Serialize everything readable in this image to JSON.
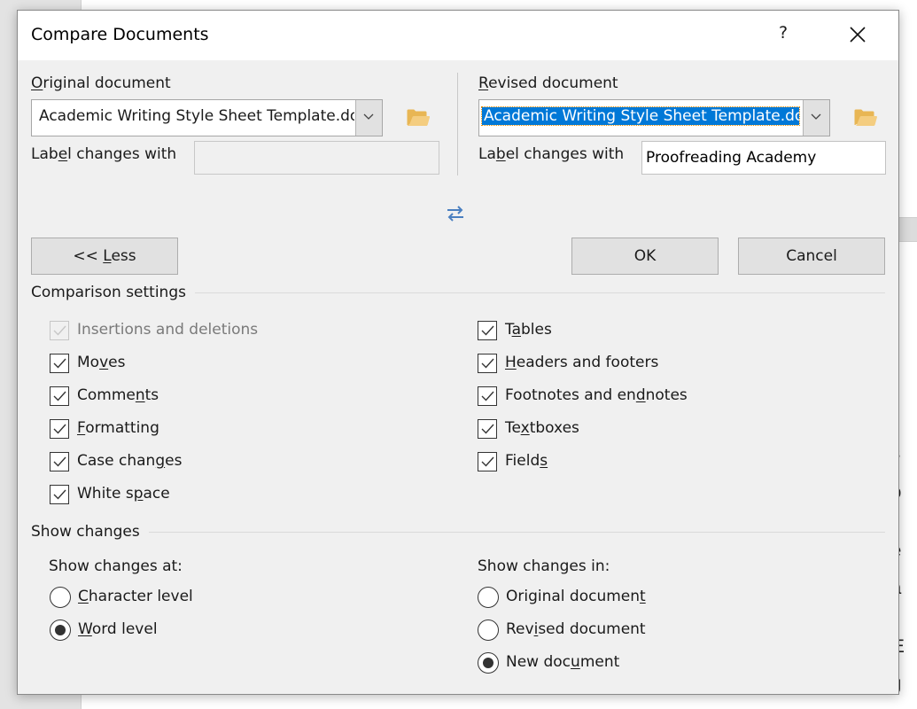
{
  "background": {
    "text_fragments": [
      "es",
      "bo",
      "he",
      "da",
      "r E",
      "ng"
    ]
  },
  "dialog": {
    "title": "Compare Documents",
    "help_label": "?",
    "original": {
      "heading_pre": "",
      "heading_ul": "O",
      "heading_post": "riginal document",
      "file": "Academic Writing Style Sheet Template.docx",
      "label_pre": "Lab",
      "label_ul": "e",
      "label_post": "l changes with",
      "label_value": ""
    },
    "revised": {
      "heading_pre": "",
      "heading_ul": "R",
      "heading_post": "evised document",
      "file": "Academic Writing Style Sheet Template.docx",
      "label_pre": "La",
      "label_ul": "b",
      "label_post": "el changes with",
      "label_value": "Proofreading Academy"
    },
    "buttons": {
      "less_pre": "<< ",
      "less_ul": "L",
      "less_post": "ess",
      "ok": "OK",
      "cancel": "Cancel"
    },
    "comparison_settings": {
      "title": "Comparison settings",
      "left": [
        {
          "pre": "Insertions and deletions",
          "ul": "",
          "post": "",
          "checked": true,
          "disabled": true
        },
        {
          "pre": "Mo",
          "ul": "v",
          "post": "es",
          "checked": true,
          "disabled": false
        },
        {
          "pre": "Comme",
          "ul": "n",
          "post": "ts",
          "checked": true,
          "disabled": false
        },
        {
          "pre": "",
          "ul": "F",
          "post": "ormatting",
          "checked": true,
          "disabled": false
        },
        {
          "pre": "Case chan",
          "ul": "g",
          "post": "es",
          "checked": true,
          "disabled": false
        },
        {
          "pre": "White s",
          "ul": "p",
          "post": "ace",
          "checked": true,
          "disabled": false
        }
      ],
      "right": [
        {
          "pre": "T",
          "ul": "a",
          "post": "bles",
          "checked": true,
          "disabled": false
        },
        {
          "pre": "",
          "ul": "H",
          "post": "eaders and footers",
          "checked": true,
          "disabled": false
        },
        {
          "pre": "Footnotes and en",
          "ul": "d",
          "post": "notes",
          "checked": true,
          "disabled": false
        },
        {
          "pre": "Te",
          "ul": "x",
          "post": "tboxes",
          "checked": true,
          "disabled": false
        },
        {
          "pre": "Field",
          "ul": "s",
          "post": "",
          "checked": true,
          "disabled": false
        }
      ]
    },
    "show_changes": {
      "title": "Show changes",
      "at_label": "Show changes at:",
      "at_options": [
        {
          "pre": "",
          "ul": "C",
          "post": "haracter level",
          "selected": false
        },
        {
          "pre": "",
          "ul": "W",
          "post": "ord level",
          "selected": true
        }
      ],
      "in_label": "Show changes in:",
      "in_options": [
        {
          "pre": "Original documen",
          "ul": "t",
          "post": "",
          "selected": false
        },
        {
          "pre": "Rev",
          "ul": "i",
          "post": "sed document",
          "selected": false
        },
        {
          "pre": "New doc",
          "ul": "u",
          "post": "ment",
          "selected": true
        }
      ]
    }
  },
  "colors": {
    "selection": "#0078d7",
    "folder": "#f0c36d",
    "swap_icon": "#4a7fc0"
  }
}
